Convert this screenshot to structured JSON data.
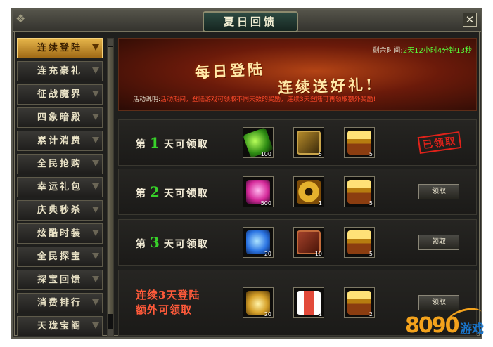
{
  "window": {
    "title": "夏日回馈",
    "close_glyph": "✕"
  },
  "sidebar": {
    "items": [
      {
        "label": "连续登陆",
        "active": true
      },
      {
        "label": "连充豪礼",
        "active": false
      },
      {
        "label": "征战魔界",
        "active": false
      },
      {
        "label": "四象暗殿",
        "active": false
      },
      {
        "label": "累计消费",
        "active": false
      },
      {
        "label": "全民抢购",
        "active": false
      },
      {
        "label": "幸运礼包",
        "active": false
      },
      {
        "label": "庆典秒杀",
        "active": false
      },
      {
        "label": "炫酷时装",
        "active": false
      },
      {
        "label": "全民探宝",
        "active": false
      },
      {
        "label": "探宝回馈",
        "active": false
      },
      {
        "label": "消费排行",
        "active": false
      },
      {
        "label": "天珑宝阁",
        "active": false
      }
    ]
  },
  "banner": {
    "timer_label": "剩余时间:",
    "timer_value": "2天12小时4分钟13秒",
    "headline_1": "每日登陆",
    "headline_2": "连续送好礼!",
    "desc_label": "活动说明:",
    "desc_text": "活动期间，登陆游戏可领取不同天数的奖励，连续3天登陆可再领取额外奖励!"
  },
  "rewards": {
    "day_prefix": "第",
    "day_suffix": "天可领取",
    "rows": [
      {
        "day": "1",
        "items": [
          {
            "icon": "green-dragon-icon",
            "count": "100"
          },
          {
            "icon": "golden-card-icon",
            "count": "5"
          },
          {
            "icon": "gold-chest-icon",
            "count": "5"
          }
        ],
        "status": "已领取"
      },
      {
        "day": "2",
        "items": [
          {
            "icon": "pink-crystal-icon",
            "count": "500"
          },
          {
            "icon": "copper-coin-icon",
            "count": "1"
          },
          {
            "icon": "gold-chest-icon",
            "count": "5"
          }
        ],
        "button": "领取"
      },
      {
        "day": "3",
        "items": [
          {
            "icon": "blue-crystal-icon",
            "count": "20"
          },
          {
            "icon": "red-book-icon",
            "count": "10"
          },
          {
            "icon": "gold-chest-icon",
            "count": "5"
          }
        ],
        "button": "领取"
      }
    ],
    "bonus": {
      "label_line1": "连续3天登陆",
      "label_line2": "额外可领取",
      "items": [
        {
          "icon": "golden-wing-icon",
          "count": "20"
        },
        {
          "icon": "red-scroll-icon",
          "count": "1"
        },
        {
          "icon": "gold-chest-icon",
          "count": "2"
        }
      ],
      "button": "领取"
    }
  },
  "logo": {
    "digits": "8090",
    "text": "游戏"
  },
  "colors": {
    "accent_gold": "#e6b54a",
    "day_number_green": "#38d22a",
    "bonus_red": "#ff5a3a",
    "timer_green": "#57ff3a"
  }
}
